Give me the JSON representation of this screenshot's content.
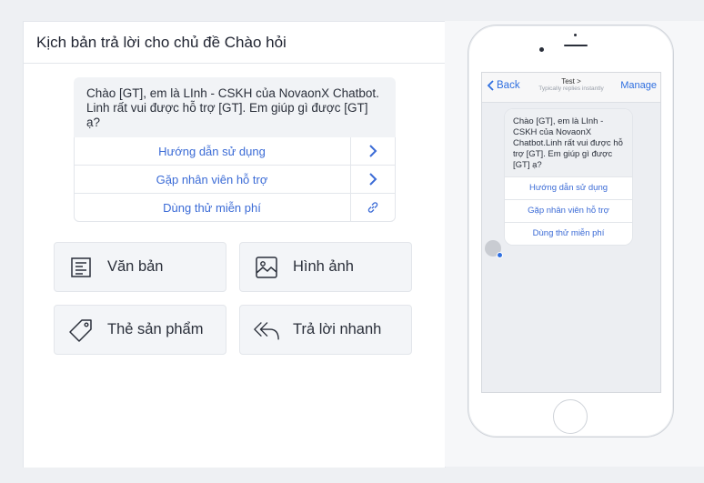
{
  "editor": {
    "title": "Kịch bản trả lời cho chủ đề Chào hỏi"
  },
  "message": {
    "text": "Chào [GT], em là LInh - CSKH của NovaonX Chatbot. Linh rất vui được hỗ trợ [GT]. Em giúp gì được [GT] ạ?",
    "buttons": [
      {
        "label": "Hướng dẫn sử dụng",
        "action_icon": "chevron-right-icon"
      },
      {
        "label": "Gặp nhân viên hỗ trợ",
        "action_icon": "chevron-right-icon"
      },
      {
        "label": "Dùng thử miễn phí",
        "action_icon": "link-icon"
      }
    ]
  },
  "content_types": [
    {
      "label": "Văn bản",
      "icon": "text-document-icon"
    },
    {
      "label": "Hình ảnh",
      "icon": "image-icon"
    },
    {
      "label": "Thẻ sản phẩm",
      "icon": "tag-icon"
    },
    {
      "label": "Trả lời nhanh",
      "icon": "reply-all-icon"
    }
  ],
  "preview": {
    "nav": {
      "back": "Back",
      "title": "Test >",
      "subtitle": "Typically replies instantly",
      "manage": "Manage"
    },
    "bubble_text": "Chào [GT], em là LInh - CSKH của NovaonX Chatbot.Linh rất vui được hỗ trợ [GT]. Em giúp gì được [GT] ạ?",
    "buttons": [
      "Hướng dẫn sử dụng",
      "Gặp nhân viên hỗ trợ",
      "Dùng thử miễn phí"
    ]
  },
  "colors": {
    "accent": "#3b6bd6",
    "ios_blue": "#2f6fe0"
  }
}
